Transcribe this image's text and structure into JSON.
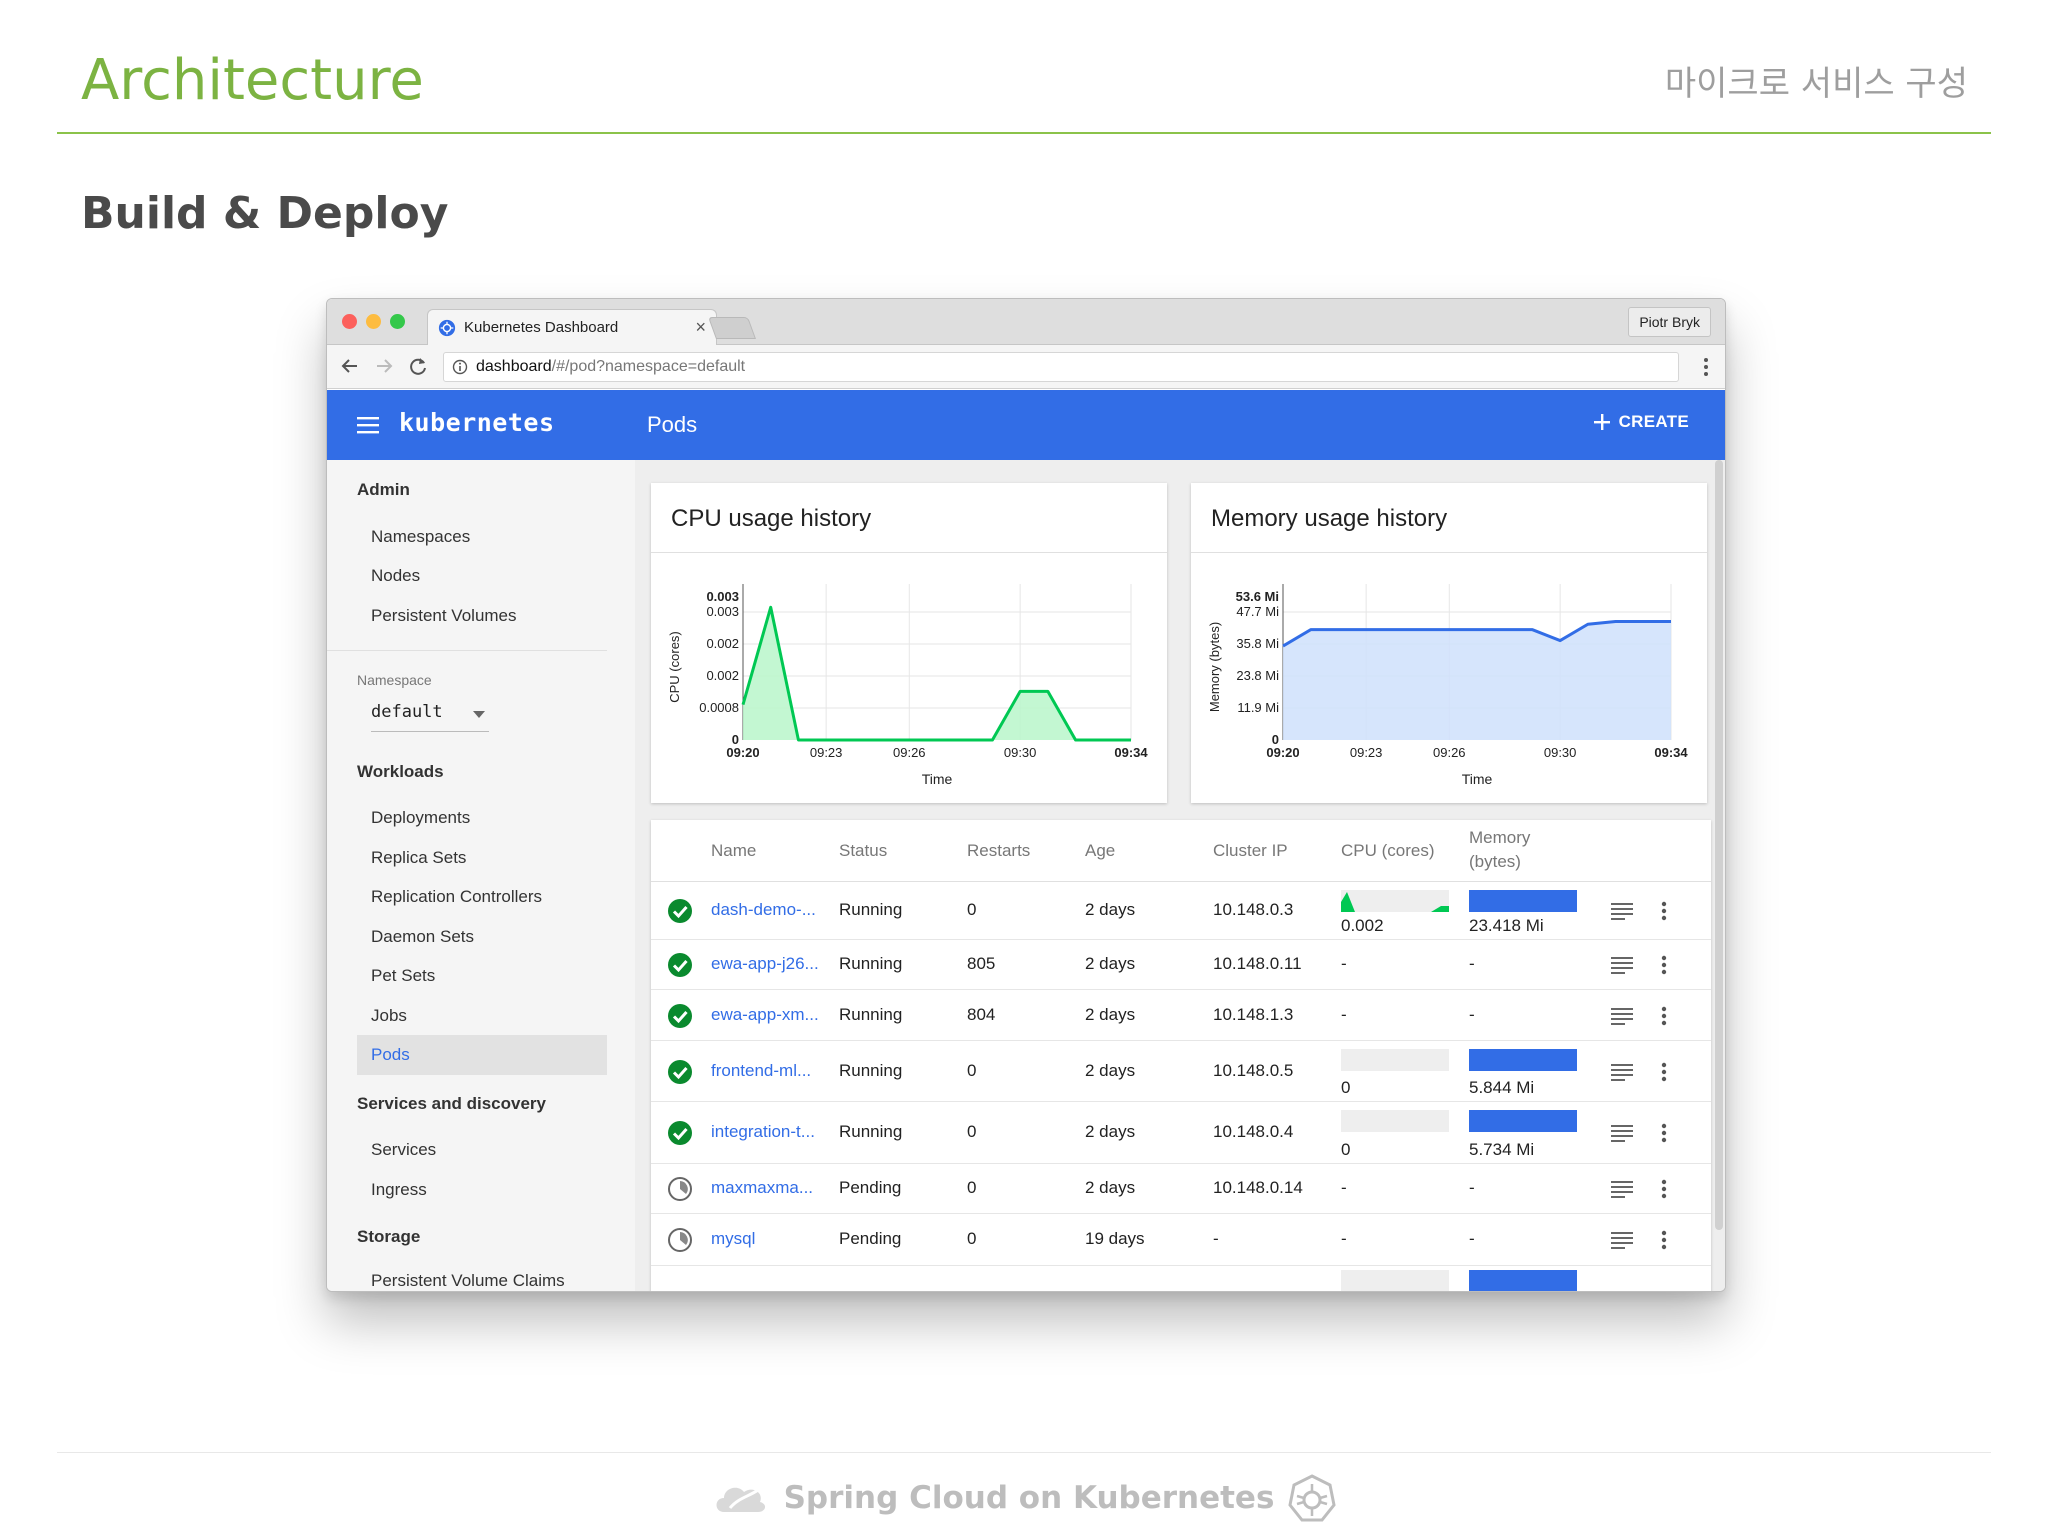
{
  "slide": {
    "title": "Architecture",
    "subtitle": "마이크로 서비스 구성",
    "section": "Build & Deploy",
    "footer": "Spring Cloud on Kubernetes"
  },
  "browser": {
    "tab_title": "Kubernetes Dashboard",
    "tab_close": "×",
    "profile": "Piotr Bryk",
    "url_host": "dashboard",
    "url_path": "/#/pod?namespace=default"
  },
  "app": {
    "brand": "kubernetes",
    "page_title": "Pods",
    "create_label": "CREATE",
    "accent": "#326de6"
  },
  "sidebar": {
    "admin_title": "Admin",
    "admin_items": [
      "Namespaces",
      "Nodes",
      "Persistent Volumes"
    ],
    "namespace_label": "Namespace",
    "namespace_value": "default",
    "workloads_title": "Workloads",
    "workloads_items": [
      "Deployments",
      "Replica Sets",
      "Replication Controllers",
      "Daemon Sets",
      "Pet Sets",
      "Jobs",
      "Pods"
    ],
    "discovery_title": "Services and discovery",
    "discovery_items": [
      "Services",
      "Ingress"
    ],
    "storage_title": "Storage",
    "storage_items": [
      "Persistent Volume Claims"
    ]
  },
  "cpu_card": {
    "title": "CPU usage history"
  },
  "mem_card": {
    "title": "Memory usage history"
  },
  "chart_data": [
    {
      "type": "area",
      "title": "CPU usage history",
      "xlabel": "Time",
      "ylabel": "CPU (cores)",
      "x_ticks": [
        "09:20",
        "09:23",
        "09:26",
        "09:30",
        "09:34"
      ],
      "y_ticks": [
        "0",
        "0.0008",
        "0.002",
        "0.002",
        "0.003",
        "0.003"
      ],
      "ylim": [
        0,
        0.0033
      ],
      "x": [
        "09:20",
        "09:21",
        "09:22",
        "09:23",
        "09:24",
        "09:25",
        "09:26",
        "09:27",
        "09:28",
        "09:29",
        "09:30",
        "09:31",
        "09:32",
        "09:33",
        "09:34"
      ],
      "series": [
        {
          "values": [
            0.0008,
            0.003,
            0,
            0,
            0,
            0,
            0,
            0,
            0,
            0,
            0.0011,
            0.0011,
            0,
            0,
            0
          ]
        }
      ],
      "color": "#00c853",
      "grid": true
    },
    {
      "type": "area",
      "title": "Memory usage history",
      "xlabel": "Time",
      "ylabel": "Memory (bytes)",
      "x_ticks": [
        "09:20",
        "09:23",
        "09:26",
        "09:30",
        "09:34"
      ],
      "y_ticks": [
        "0",
        "11.9 Mi",
        "23.8 Mi",
        "35.8 Mi",
        "47.7 Mi",
        "53.6 Mi"
      ],
      "ylim": [
        0,
        53.6
      ],
      "x": [
        "09:20",
        "09:21",
        "09:23",
        "09:26",
        "09:29",
        "09:30",
        "09:31",
        "09:32",
        "09:34"
      ],
      "series": [
        {
          "values": [
            34.5,
            40.5,
            40.5,
            40.5,
            40.5,
            36.5,
            42.5,
            43.5,
            43.5
          ]
        }
      ],
      "color": "#326de6",
      "fill": "#cfe0fb",
      "grid": true
    }
  ],
  "table": {
    "headers": [
      "Name",
      "Status",
      "Restarts",
      "Age",
      "Cluster IP",
      "CPU (cores)",
      "Memory",
      "(bytes)"
    ],
    "rows": [
      {
        "name": "dash-demo-...",
        "status": "Running",
        "restarts": "0",
        "age": "2 days",
        "ip": "10.148.0.3",
        "cpu": "0.002",
        "mem": "23.418 Mi",
        "ok": true,
        "spark": true
      },
      {
        "name": "ewa-app-j26...",
        "status": "Running",
        "restarts": "805",
        "age": "2 days",
        "ip": "10.148.0.11",
        "cpu": "-",
        "mem": "-",
        "ok": true,
        "spark": false
      },
      {
        "name": "ewa-app-xm...",
        "status": "Running",
        "restarts": "804",
        "age": "2 days",
        "ip": "10.148.1.3",
        "cpu": "-",
        "mem": "-",
        "ok": true,
        "spark": false
      },
      {
        "name": "frontend-ml...",
        "status": "Running",
        "restarts": "0",
        "age": "2 days",
        "ip": "10.148.0.5",
        "cpu": "0",
        "mem": "5.844 Mi",
        "ok": true,
        "spark": true
      },
      {
        "name": "integration-t...",
        "status": "Running",
        "restarts": "0",
        "age": "2 days",
        "ip": "10.148.0.4",
        "cpu": "0",
        "mem": "5.734 Mi",
        "ok": true,
        "spark": true
      },
      {
        "name": "maxmaxma...",
        "status": "Pending",
        "restarts": "0",
        "age": "2 days",
        "ip": "10.148.0.14",
        "cpu": "-",
        "mem": "-",
        "ok": false,
        "spark": false
      },
      {
        "name": "mysql",
        "status": "Pending",
        "restarts": "0",
        "age": "19 days",
        "ip": "-",
        "cpu": "-",
        "mem": "-",
        "ok": false,
        "spark": false
      }
    ]
  }
}
